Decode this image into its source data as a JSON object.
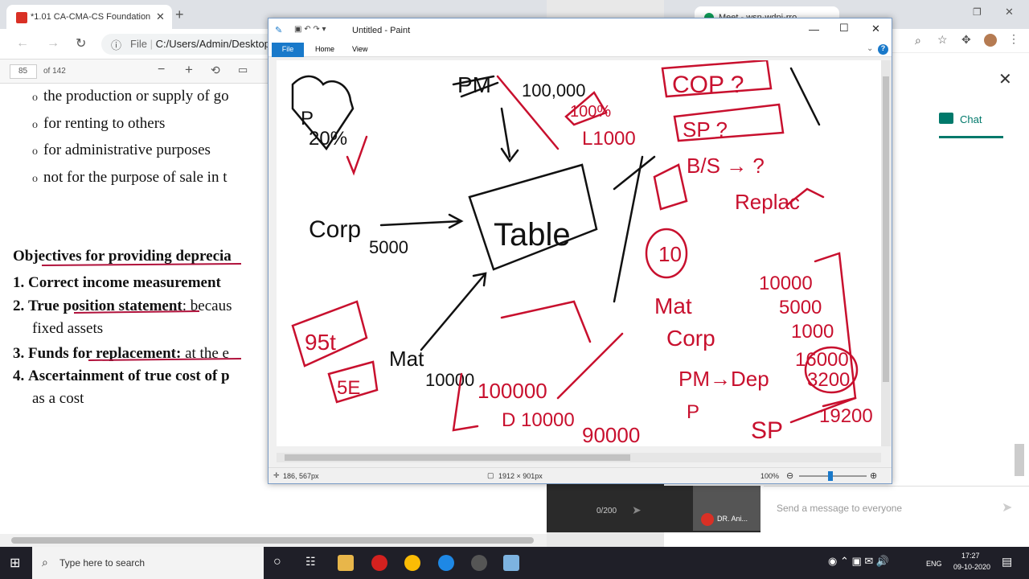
{
  "pdf_window": {
    "tab_title": "*1.01 CA-CMA-CS Foundation",
    "url": "C:/Users/Admin/Desktop",
    "file_label": "File",
    "page_current": "85",
    "page_total": "of 142",
    "bullets": [
      "the production or supply of go",
      "for renting to others",
      "for administrative purposes",
      "not for the purpose of sale in t"
    ],
    "heading": "Objectives for providing deprecia",
    "items": [
      {
        "num": "1.",
        "bold": "Correct income measurement",
        "rest": ""
      },
      {
        "num": "2.",
        "bold": "True position statement",
        "rest": ": becaus"
      },
      {
        "num": "",
        "bold": "",
        "rest": "fixed assets"
      },
      {
        "num": "3.",
        "bold": "Funds for replacement:",
        "rest": " at the e"
      },
      {
        "num": "4.",
        "bold": "Ascertainment of true cost of p",
        "rest": ""
      },
      {
        "num": "",
        "bold": "",
        "rest": "as a cost"
      }
    ]
  },
  "meet_window": {
    "tab_title": "Meet - wsn-wdnj-rro",
    "chat_label": "Chat",
    "message_placeholder": "Send a message to everyone",
    "char_count": "0/200",
    "participant_name": "DR. Ani..."
  },
  "paint": {
    "title": "Untitled - Paint",
    "ribbon_tabs": [
      "File",
      "Home",
      "View"
    ],
    "cursor_pos": "186, 567px",
    "canvas_size": "1912 × 901px",
    "zoom": "100%",
    "annotations_black": [
      "PM",
      "100,000",
      "Corp",
      "5000",
      "Table",
      "Mat",
      "10000",
      "P",
      "20%"
    ],
    "annotations_red": [
      "100%",
      "L1000",
      "COP ?",
      "SP ?",
      "B/S → ?",
      "Replac",
      "10",
      "10000",
      "5000",
      "1000",
      "16000",
      "3200",
      "19200",
      "Mat",
      "Corp",
      "PM→Dep",
      "P",
      "SP",
      "100000",
      "D 10000",
      "90000",
      "95t",
      "5E"
    ]
  },
  "taskbar": {
    "search_placeholder": "Type here to search",
    "lang": "ENG",
    "time": "17:27",
    "date": "09-10-2020"
  }
}
